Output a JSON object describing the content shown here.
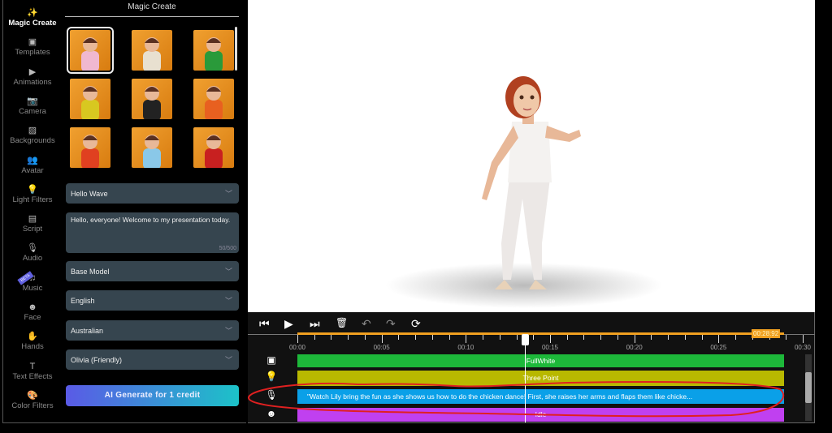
{
  "nav": [
    {
      "label": "Magic Create",
      "icon": "magic-wand-icon",
      "glyph": "✨",
      "active": true
    },
    {
      "label": "Templates",
      "icon": "template-icon",
      "glyph": "▣"
    },
    {
      "label": "Animations",
      "icon": "animation-icon",
      "glyph": "▶"
    },
    {
      "label": "Camera",
      "icon": "camera-icon",
      "glyph": "📷"
    },
    {
      "label": "Backgrounds",
      "icon": "background-icon",
      "glyph": "▨"
    },
    {
      "label": "Avatar",
      "icon": "avatar-icon",
      "glyph": "👥"
    },
    {
      "label": "Light Filters",
      "icon": "lightbulb-icon",
      "glyph": "💡"
    },
    {
      "label": "Script",
      "icon": "document-icon",
      "glyph": "▤"
    },
    {
      "label": "Audio",
      "icon": "microphone-icon",
      "glyph": "🎙"
    },
    {
      "label": "Music",
      "icon": "music-icon",
      "glyph": "♫",
      "badge": "BETA"
    },
    {
      "label": "Face",
      "icon": "face-icon",
      "glyph": "☻"
    },
    {
      "label": "Hands",
      "icon": "hand-icon",
      "glyph": "✋"
    },
    {
      "label": "Text Effects",
      "icon": "text-icon",
      "glyph": "T"
    },
    {
      "label": "Color Filters",
      "icon": "palette-icon",
      "glyph": "🎨"
    }
  ],
  "panel": {
    "title": "Magic Create",
    "avatars": [
      {
        "name": "bunny",
        "shirt": "#f0b8d0",
        "selected": true
      },
      {
        "name": "skeleton",
        "shirt": "#e8e0d0"
      },
      {
        "name": "elf",
        "shirt": "#2a9a3a"
      },
      {
        "name": "yellow-jacket",
        "shirt": "#d8c820"
      },
      {
        "name": "striped",
        "shirt": "#222"
      },
      {
        "name": "orange-shirt",
        "shirt": "#e86020"
      },
      {
        "name": "red-shirt",
        "shirt": "#e04020"
      },
      {
        "name": "hat",
        "shirt": "#8ac8e8"
      },
      {
        "name": "red-top",
        "shirt": "#c82020"
      }
    ],
    "animation": "Hello Wave",
    "script_text": "Hello, everyone! Welcome to my presentation today.",
    "char_count": "50/500",
    "model": "Base Model",
    "language": "English",
    "accent": "Australian",
    "voice": "Olivia (Friendly)",
    "generate_label": "AI Generate for 1 credit"
  },
  "timeline": {
    "end_time": "00:28:92",
    "tick_labels": [
      "00:00",
      "00:05",
      "00:10",
      "00:15",
      "00:20",
      "00:25",
      "00:30"
    ],
    "playhead_seconds": 13.5,
    "tracks": [
      {
        "icon": "background-icon",
        "glyph": "▣",
        "label": "FullWhite",
        "color": "#1db83a"
      },
      {
        "icon": "lightbulb-icon",
        "glyph": "💡",
        "label": "Three Point",
        "color": "#b8b800"
      },
      {
        "icon": "microphone-icon",
        "glyph": "🎙",
        "label": "\"Watch Lily bring the fun as she shows us how to do the chicken dance! First, she raises her arms and flaps them like chicke...",
        "color": "#0aa0e8"
      },
      {
        "icon": "face-icon",
        "glyph": "☻",
        "label": "Idle",
        "color": "#c040f0"
      }
    ]
  },
  "annotation_color": "#e02020"
}
